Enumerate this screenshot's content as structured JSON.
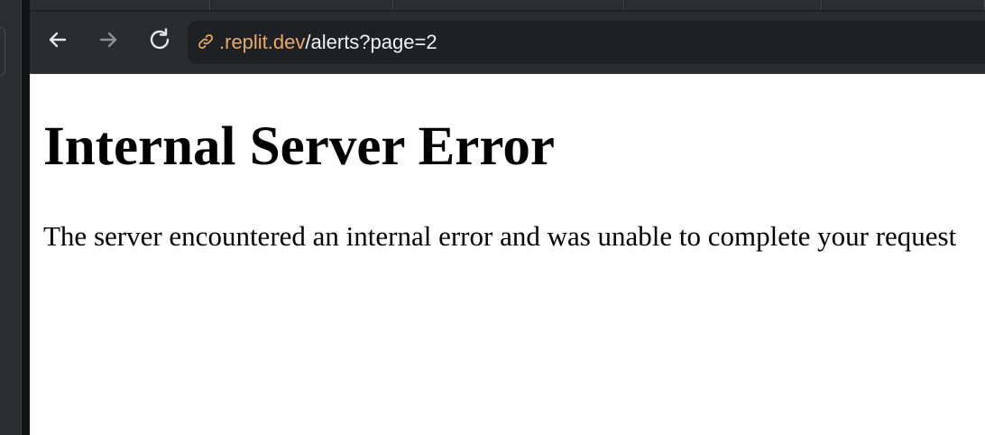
{
  "browser": {
    "url": {
      "domain": ".replit.dev",
      "path": "/alerts?page=2"
    },
    "icons": {
      "back": "back-arrow-icon",
      "forward": "forward-arrow-icon",
      "reload": "reload-icon",
      "site_info": "link-icon"
    },
    "colors": {
      "url_domain": "#e8a86a",
      "chrome_background": "#2b2c30",
      "omnibox_background": "#1f2023"
    }
  },
  "page": {
    "title": "Internal Server Error",
    "message": "The server encountered an internal error and was unable to complete your request"
  }
}
